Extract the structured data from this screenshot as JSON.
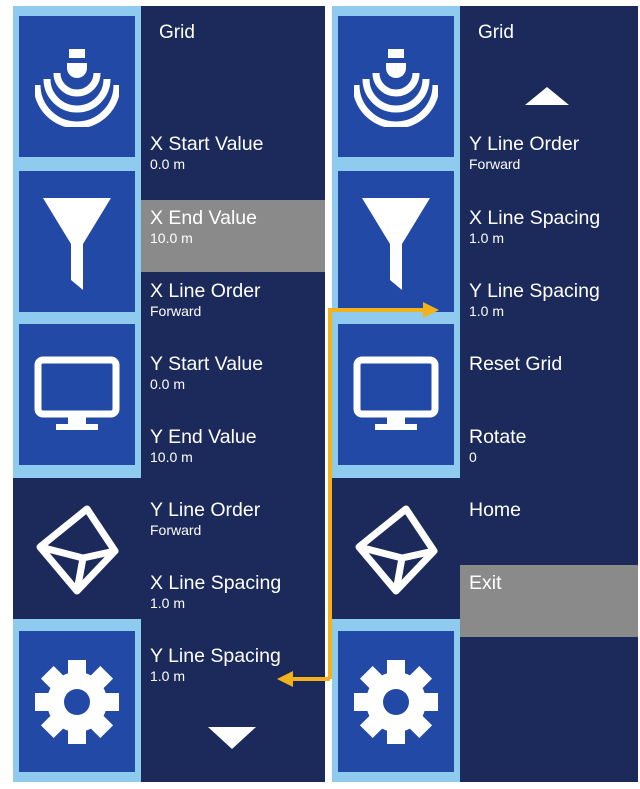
{
  "colors": {
    "panel_background": "#1b2a5a",
    "rail_background": "#8fcbee",
    "tile_background": "#2149a5",
    "active_item": "#8a8a8a",
    "text": "#ffffff",
    "connector": "#f3b21b"
  },
  "left_panel": {
    "title": "Grid",
    "rail_icons": [
      "sonar-icon",
      "funnel-icon",
      "monitor-icon",
      "cube-icon",
      "gear-icon"
    ],
    "items": [
      {
        "label": "X Start Value",
        "value": "0.0 m"
      },
      {
        "label": "X End Value",
        "value": "10.0 m",
        "active": true
      },
      {
        "label": "X Line Order",
        "value": "Forward"
      },
      {
        "label": "Y Start Value",
        "value": "0.0 m"
      },
      {
        "label": "Y End Value",
        "value": "10.0 m"
      },
      {
        "label": "Y Line Order",
        "value": "Forward"
      },
      {
        "label": "X Line Spacing",
        "value": "1.0 m"
      },
      {
        "label": "Y Line Spacing",
        "value": "1.0 m"
      }
    ],
    "scroll_indicator": "scroll-down-arrow-icon"
  },
  "right_panel": {
    "title": "Grid",
    "rail_icons": [
      "sonar-icon",
      "funnel-icon",
      "monitor-icon",
      "cube-icon",
      "gear-icon"
    ],
    "scroll_indicator": "scroll-up-arrow-icon",
    "items": [
      {
        "label": "Y Line Order",
        "value": "Forward"
      },
      {
        "label": "X Line Spacing",
        "value": "1.0 m"
      },
      {
        "label": "Y Line Spacing",
        "value": "1.0 m"
      },
      {
        "label": "Reset Grid",
        "value": ""
      },
      {
        "label": "Rotate",
        "value": "0"
      },
      {
        "label": "Home",
        "value": ""
      },
      {
        "label": "Exit",
        "value": "",
        "active": true
      }
    ]
  },
  "connector_arrows": "connector-arrow-icon"
}
